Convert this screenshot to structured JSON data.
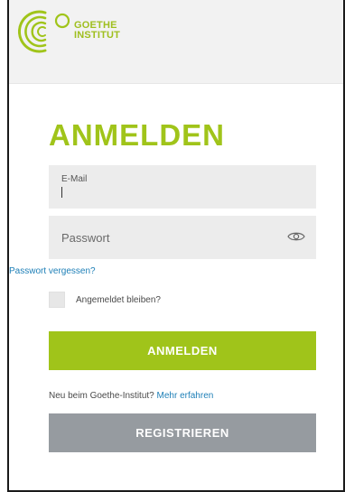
{
  "brand": {
    "line1": "GOETHE",
    "line2": "INSTITUT",
    "color": "#a0c41a"
  },
  "login": {
    "title": "ANMELDEN",
    "email_label": "E-Mail",
    "password_placeholder": "Passwort",
    "forgot_link": "Passwort vergessen?",
    "remember_label": "Angemeldet bleiben?",
    "submit_label": "ANMELDEN",
    "password_toggle_icon": "eye-icon"
  },
  "register": {
    "prompt": "Neu beim Goethe-Institut?",
    "more_link": "Mehr erfahren",
    "button_label": "REGISTRIEREN",
    "button_color": "#969ba0"
  },
  "colors": {
    "link": "#1d7fb7",
    "field_bg": "#ececec"
  }
}
